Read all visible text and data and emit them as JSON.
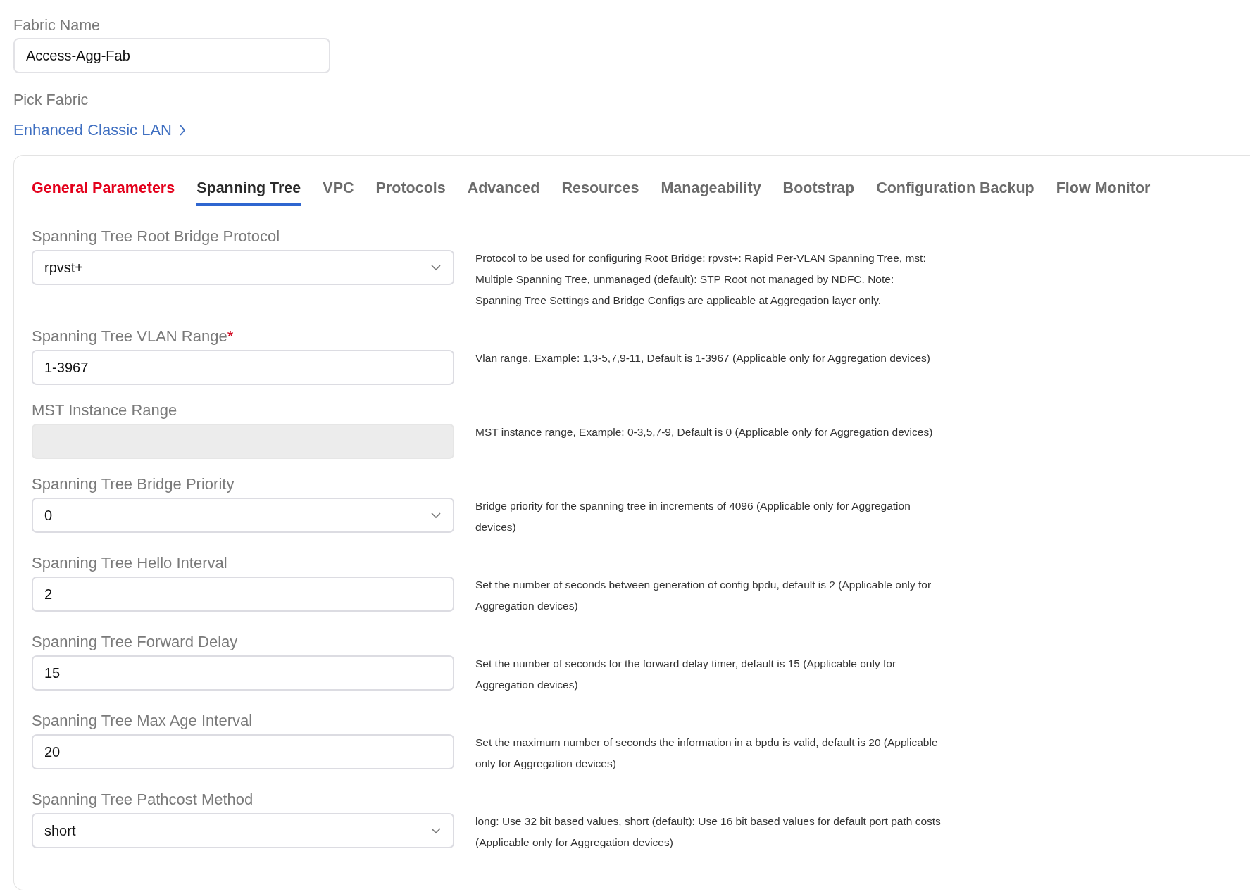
{
  "fabric_name": {
    "label": "Fabric Name",
    "value": "Access-Agg-Fab"
  },
  "pick_fabric": {
    "label": "Pick Fabric",
    "link": "Enhanced Classic LAN"
  },
  "tabs": [
    {
      "label": "General Parameters",
      "selected": false,
      "error": true
    },
    {
      "label": "Spanning Tree",
      "selected": true,
      "error": false
    },
    {
      "label": "VPC",
      "selected": false,
      "error": false
    },
    {
      "label": "Protocols",
      "selected": false,
      "error": false
    },
    {
      "label": "Advanced",
      "selected": false,
      "error": false
    },
    {
      "label": "Resources",
      "selected": false,
      "error": false
    },
    {
      "label": "Manageability",
      "selected": false,
      "error": false
    },
    {
      "label": "Bootstrap",
      "selected": false,
      "error": false
    },
    {
      "label": "Configuration Backup",
      "selected": false,
      "error": false
    },
    {
      "label": "Flow Monitor",
      "selected": false,
      "error": false
    }
  ],
  "fields": [
    {
      "kind": "select",
      "label": "Spanning Tree Root Bridge Protocol",
      "disabled": false,
      "value": "rpvst+",
      "help": "Protocol to be used for configuring Root Bridge: rpvst+: Rapid Per-VLAN Spanning Tree, mst: Multiple Spanning Tree, unmanaged (default): STP Root not managed by NDFC. Note: Spanning Tree Settings and Bridge Configs are applicable at Aggregation layer only."
    },
    {
      "kind": "text",
      "label": "Spanning Tree VLAN Range",
      "required_mark": "*",
      "disabled": false,
      "value": "1-3967",
      "help": "Vlan range, Example: 1,3-5,7,9-11, Default is 1-3967 (Applicable only for Aggregation devices)"
    },
    {
      "kind": "text",
      "label": "MST Instance Range",
      "disabled": true,
      "help": "MST instance range, Example: 0-3,5,7-9, Default is 0 (Applicable only for Aggregation devices)"
    },
    {
      "kind": "select",
      "label": "Spanning Tree Bridge Priority",
      "disabled": false,
      "value": "0",
      "help": "Bridge priority for the spanning tree in increments of 4096 (Applicable only for Aggregation devices)"
    },
    {
      "kind": "text",
      "label": "Spanning Tree Hello Interval",
      "disabled": false,
      "value": "2",
      "help": "Set the number of seconds between generation of config bpdu, default is 2 (Applicable only for Aggregation devices)"
    },
    {
      "kind": "text",
      "label": "Spanning Tree Forward Delay",
      "disabled": false,
      "value": "15",
      "help": "Set the number of seconds for the forward delay timer, default is 15 (Applicable only for Aggregation devices)"
    },
    {
      "kind": "text",
      "label": "Spanning Tree Max Age Interval",
      "disabled": false,
      "value": "20",
      "help": "Set the maximum number of seconds the information in a bpdu is valid, default is 20 (Applicable only for Aggregation devices)"
    },
    {
      "kind": "select",
      "label": "Spanning Tree Pathcost Method",
      "disabled": false,
      "value": "short",
      "help": "long: Use 32 bit based values, short (default): Use 16 bit based values for default port path costs (Applicable only for Aggregation devices)"
    }
  ]
}
